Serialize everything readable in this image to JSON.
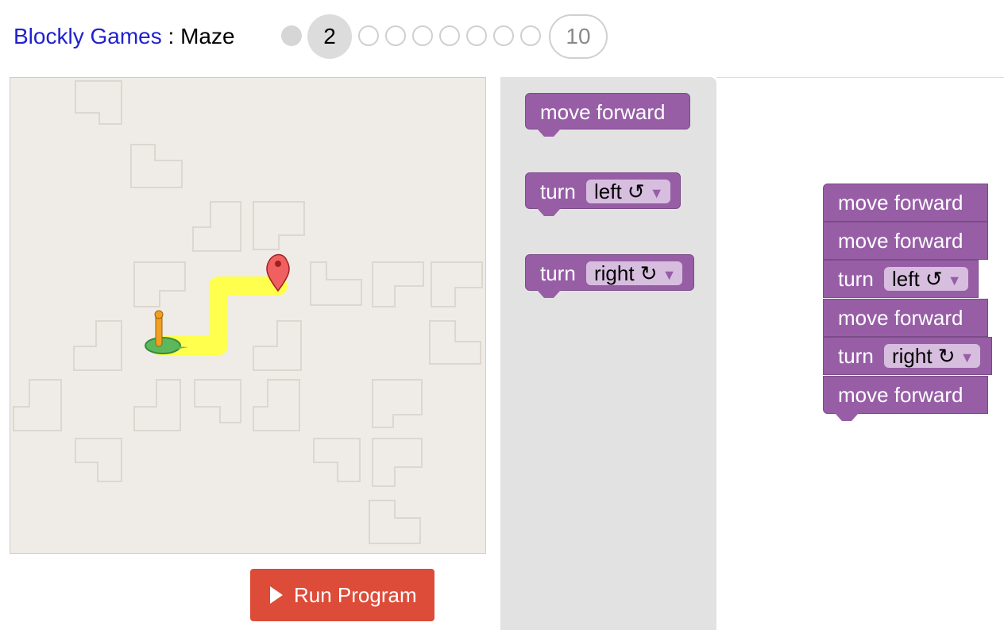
{
  "header": {
    "brand": "Blockly Games",
    "separator": " : ",
    "game": "Maze"
  },
  "levels": {
    "current": "2",
    "last": "10"
  },
  "run_button": {
    "label": "Run Program"
  },
  "toolbox": {
    "move": "move forward",
    "turn": "turn",
    "left": "left ↺",
    "right": "right ↻"
  },
  "program": {
    "b1": "move forward",
    "b2": "move forward",
    "b3_label": "turn",
    "b3_dir": "left ↺",
    "b4": "move forward",
    "b5_label": "turn",
    "b5_dir": "right ↻",
    "b6": "move forward"
  },
  "colors": {
    "block": "#975ea6",
    "run": "#dd4b39",
    "link": "#2020d0",
    "path": "#ffff4d"
  }
}
